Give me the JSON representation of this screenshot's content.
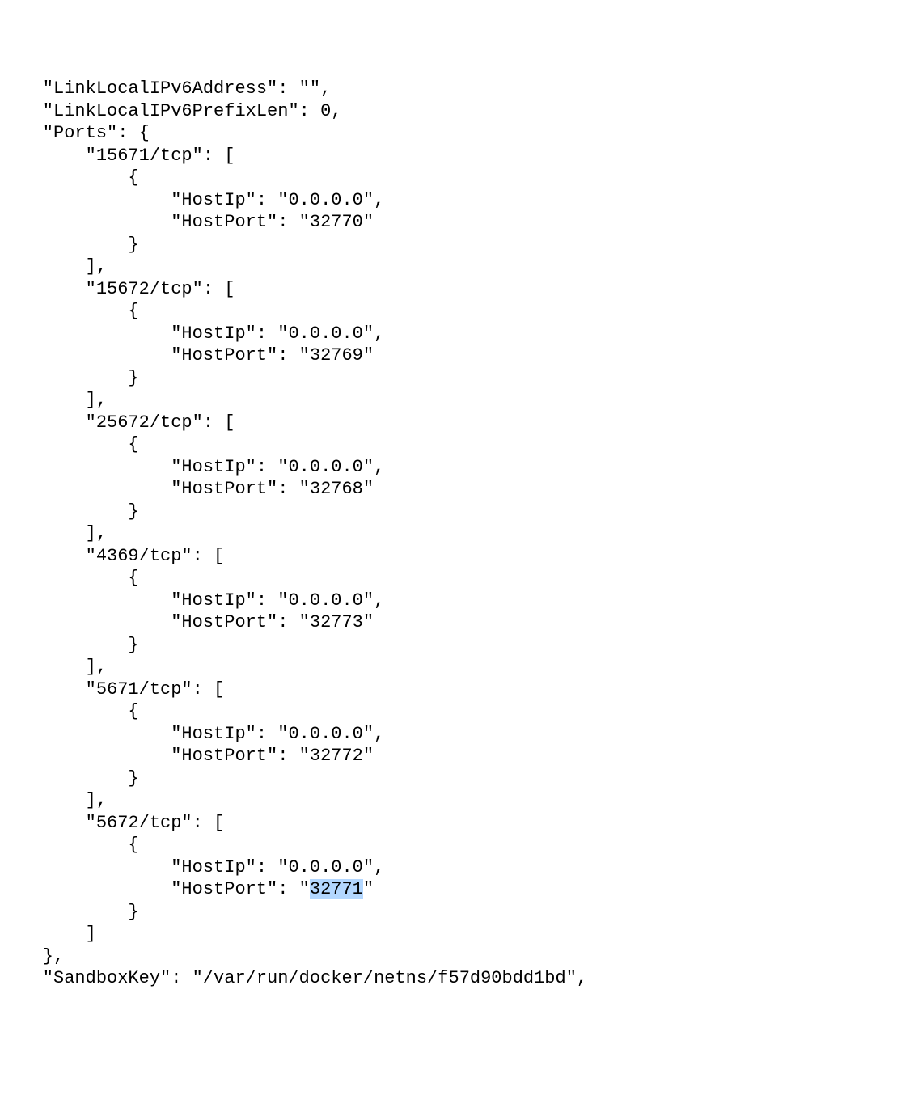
{
  "lines": {
    "l0": "    \"LinkLocalIPv6Address\": \"\",",
    "l1": "    \"LinkLocalIPv6PrefixLen\": 0,",
    "l2": "    \"Ports\": {",
    "l3": "        \"15671/tcp\": [",
    "l4": "            {",
    "l5": "                \"HostIp\": \"0.0.0.0\",",
    "l6": "                \"HostPort\": \"32770\"",
    "l7": "            }",
    "l8": "        ],",
    "l9": "        \"15672/tcp\": [",
    "l10": "            {",
    "l11": "                \"HostIp\": \"0.0.0.0\",",
    "l12": "                \"HostPort\": \"32769\"",
    "l13": "            }",
    "l14": "        ],",
    "l15": "        \"25672/tcp\": [",
    "l16": "            {",
    "l17": "                \"HostIp\": \"0.0.0.0\",",
    "l18": "                \"HostPort\": \"32768\"",
    "l19": "            }",
    "l20": "        ],",
    "l21": "        \"4369/tcp\": [",
    "l22": "            {",
    "l23": "                \"HostIp\": \"0.0.0.0\",",
    "l24": "                \"HostPort\": \"32773\"",
    "l25": "            }",
    "l26": "        ],",
    "l27": "        \"5671/tcp\": [",
    "l28": "            {",
    "l29": "                \"HostIp\": \"0.0.0.0\",",
    "l30": "                \"HostPort\": \"32772\"",
    "l31": "            }",
    "l32": "        ],",
    "l33": "        \"5672/tcp\": [",
    "l34": "            {",
    "l35": "                \"HostIp\": \"0.0.0.0\",",
    "l36a": "                \"HostPort\": \"",
    "l36b": "32771",
    "l36c": "\"",
    "l37": "            }",
    "l38": "        ]",
    "l39": "    },",
    "l40": "    \"SandboxKey\": \"/var/run/docker/netns/f57d90bdd1bd\","
  }
}
